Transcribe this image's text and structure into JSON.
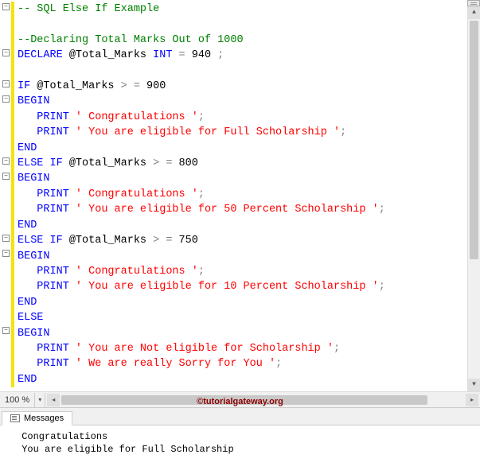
{
  "zoom": "100 %",
  "watermark": "©tutorialgateway.org",
  "messages_tab": "Messages",
  "output": {
    "line1": " Congratulations ",
    "line2": " You are eligible for Full Scholarship "
  },
  "code": {
    "l1_comment": "-- SQL Else If Example",
    "l3_comment": "--Declaring Total Marks Out of 1000",
    "l4_declare": "DECLARE",
    "l4_var": " @Total_Marks ",
    "l4_type": "INT",
    "l4_eq": " = ",
    "l4_num": "940 ",
    "l4_semi": ";",
    "l6_if": "IF",
    "l6_var": " @Total_Marks ",
    "l6_op": "> =",
    "l6_num": " 900",
    "l7_begin": "BEGIN",
    "l8_print": "   PRINT",
    "l8_str": " ' Congratulations '",
    "l8_semi": ";",
    "l9_print": "   PRINT",
    "l9_str": " ' You are eligible for Full Scholarship '",
    "l9_semi": ";",
    "l10_end": "END",
    "l11_elseif": "ELSE IF",
    "l11_var": " @Total_Marks ",
    "l11_op": "> =",
    "l11_num": " 800",
    "l12_begin": "BEGIN",
    "l13_print": "   PRINT",
    "l13_str": " ' Congratulations '",
    "l13_semi": ";",
    "l14_print": "   PRINT",
    "l14_str": " ' You are eligible for 50 Percent Scholarship '",
    "l14_semi": ";",
    "l15_end": "END",
    "l16_elseif": "ELSE IF",
    "l16_var": " @Total_Marks ",
    "l16_op": "> =",
    "l16_num": " 750",
    "l17_begin": "BEGIN",
    "l18_print": "   PRINT",
    "l18_str": " ' Congratulations '",
    "l18_semi": ";",
    "l19_print": "   PRINT",
    "l19_str": " ' You are eligible for 10 Percent Scholarship '",
    "l19_semi": ";",
    "l20_end": "END",
    "l21_else": "ELSE ",
    "l22_begin": "BEGIN",
    "l23_print": "   PRINT",
    "l23_str": " ' You are Not eligible for Scholarship '",
    "l23_semi": ";",
    "l24_print": "   PRINT",
    "l24_str": " ' We are really Sorry for You '",
    "l24_semi": ";",
    "l25_end": "END"
  }
}
